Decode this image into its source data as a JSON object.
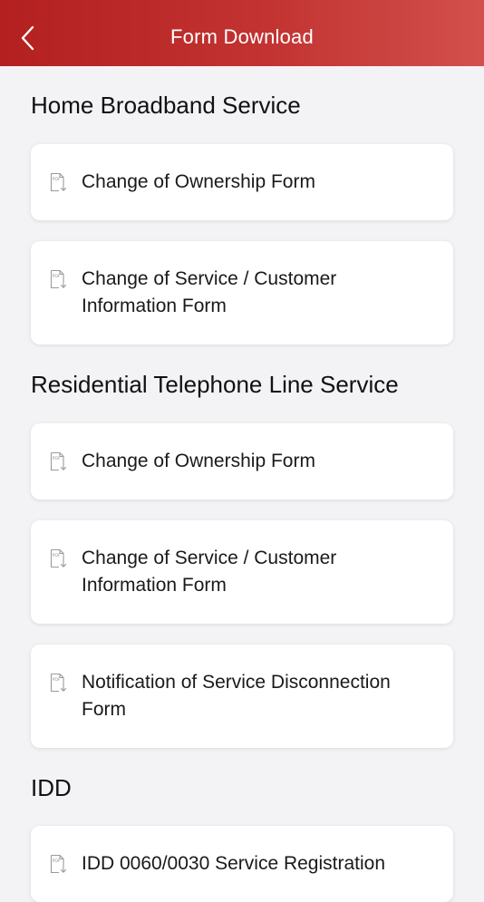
{
  "header": {
    "title": "Form Download"
  },
  "sections": [
    {
      "title": "Home Broadband Service",
      "items": [
        {
          "label": "Change of Ownership Form"
        },
        {
          "label": "Change of Service / Customer Information Form"
        }
      ]
    },
    {
      "title": "Residential Telephone Line Service",
      "items": [
        {
          "label": "Change of Ownership Form"
        },
        {
          "label": "Change of Service / Customer Information Form"
        },
        {
          "label": "Notification of Service Disconnection Form"
        }
      ]
    },
    {
      "title": "IDD",
      "items": [
        {
          "label": "IDD 0060/0030 Service Registration"
        }
      ]
    }
  ],
  "colors": {
    "header_start": "#b3201f",
    "header_end": "#d2504c",
    "background": "#f3f2f5",
    "card": "#ffffff"
  },
  "icons": {
    "back": "chevron-left-icon",
    "pdf": "pdf-download-icon"
  }
}
